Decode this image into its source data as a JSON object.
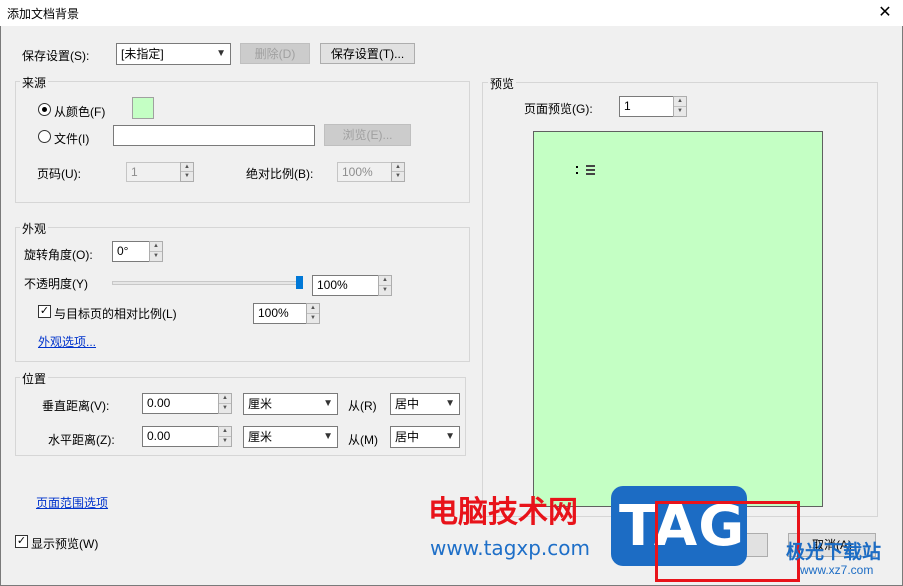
{
  "window": {
    "title": "添加文档背景",
    "close_glyph": "✕"
  },
  "save_settings": {
    "label": "保存设置(S):",
    "combo_value": "[未指定]",
    "delete_label": "删除(D)",
    "save_button_label": "保存设置(T)..."
  },
  "source": {
    "group_label": "来源",
    "from_color_label": "从颜色(F)",
    "color_swatch": "#c4ffc4",
    "file_label": "文件(I)",
    "file_value": "",
    "browse_label": "浏览(E)...",
    "page_label": "页码(U):",
    "page_value": "1",
    "abs_scale_label": "绝对比例(B):",
    "abs_scale_value": "100%"
  },
  "appearance": {
    "group_label": "外观",
    "rotation_label": "旋转角度(O):",
    "rotation_value": "0°",
    "opacity_label": "不透明度(Y)",
    "opacity_value": "100%",
    "opacity_fraction": 1.0,
    "relative_scale_label": "与目标页的相对比例(L)",
    "relative_scale_value": "100%",
    "options_link": "外观选项..."
  },
  "position": {
    "group_label": "位置",
    "vertical_label": "垂直距离(V):",
    "vertical_value": "0.00",
    "vertical_unit": "厘米",
    "vertical_from_label": "从(R)",
    "vertical_from_value": "居中",
    "horizontal_label": "水平距离(Z):",
    "horizontal_value": "0.00",
    "horizontal_unit": "厘米",
    "horizontal_from_label": "从(M)",
    "horizontal_from_value": "居中"
  },
  "page_range_link": "页面范围选项",
  "show_preview_label": "显示预览(W)",
  "preview": {
    "group_label": "预览",
    "page_preview_label": "页面预览(G):",
    "page_preview_value": "1",
    "page_color": "#c4ffc4"
  },
  "footer": {
    "ok_label": "确定(O)",
    "cancel_label": "取消(A)"
  },
  "watermark": {
    "site_name": "电脑技术网",
    "site_url": "www.tagxp.com",
    "badge": "TAG",
    "corner_name": "极光下载站",
    "corner_url": "www.xz7.com"
  },
  "icons": {
    "dropdown": "chevron-down-icon",
    "spin": "spin-arrows-icon",
    "check": "checkmark-icon"
  }
}
